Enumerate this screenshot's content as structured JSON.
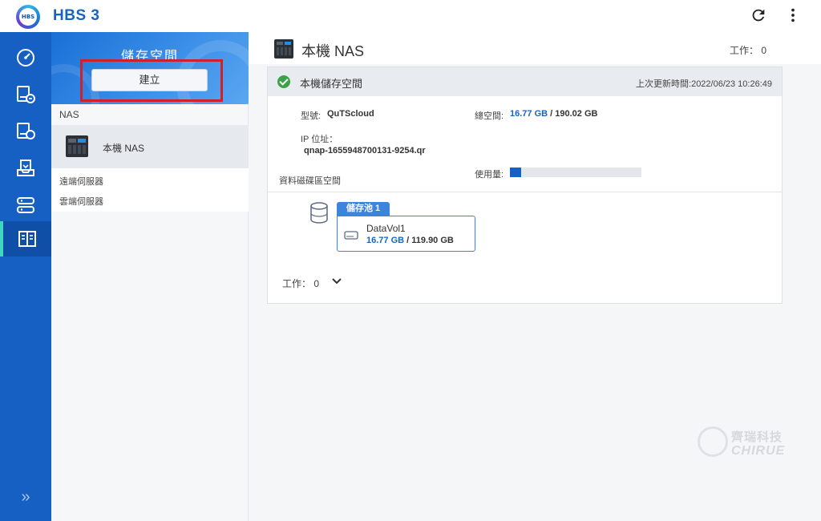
{
  "app": {
    "title": "HBS 3",
    "logo_text": "HBS"
  },
  "nav": {
    "items": [
      {
        "icon": "gauge-icon"
      },
      {
        "icon": "sync-device-icon"
      },
      {
        "icon": "backup-restore-icon"
      },
      {
        "icon": "restore-tray-icon"
      },
      {
        "icon": "servers-icon"
      },
      {
        "icon": "storage-spaces-icon",
        "active": true
      }
    ],
    "expand_label": "»"
  },
  "panel": {
    "title": "儲存空間",
    "create_label": "建立",
    "section_nas": "NAS",
    "local_nas_label": "本機 NAS",
    "remote_server_label": "遠端伺服器",
    "cloud_server_label": "雲端伺服器"
  },
  "main": {
    "title": "本機 NAS",
    "tasks": "工作： 0",
    "card": {
      "title": "本機儲存空間",
      "updated": "上次更新時間:2022/06/23 10:26:49",
      "model_label": "型號:",
      "model_value": "QuTScloud",
      "ip_label": "IP 位址：",
      "ip_value": "qnap-1655948700131-9254.qr",
      "total_label": "總空間:",
      "total_used": "16.77 GB",
      "total_sep": " / ",
      "total_capacity": "190.02 GB",
      "usage_label": "使用量:",
      "usage_fraction": 0.088,
      "data_space_label": "資料磁碟區空間",
      "pool_label": "儲存池 1",
      "volume_name": "DataVol1",
      "volume_used": "16.77 GB",
      "volume_sep": " / ",
      "volume_capacity": "119.90 GB",
      "tasks_label": "工作： 0"
    }
  },
  "watermark": {
    "cn": "齊瑞科技",
    "en": "CHIRUE"
  },
  "colors": {
    "brand_blue": "#1660c4",
    "accent_teal": "#3fd7c0",
    "highlight_red": "#d0202c",
    "ok_green": "#3ba24a"
  }
}
